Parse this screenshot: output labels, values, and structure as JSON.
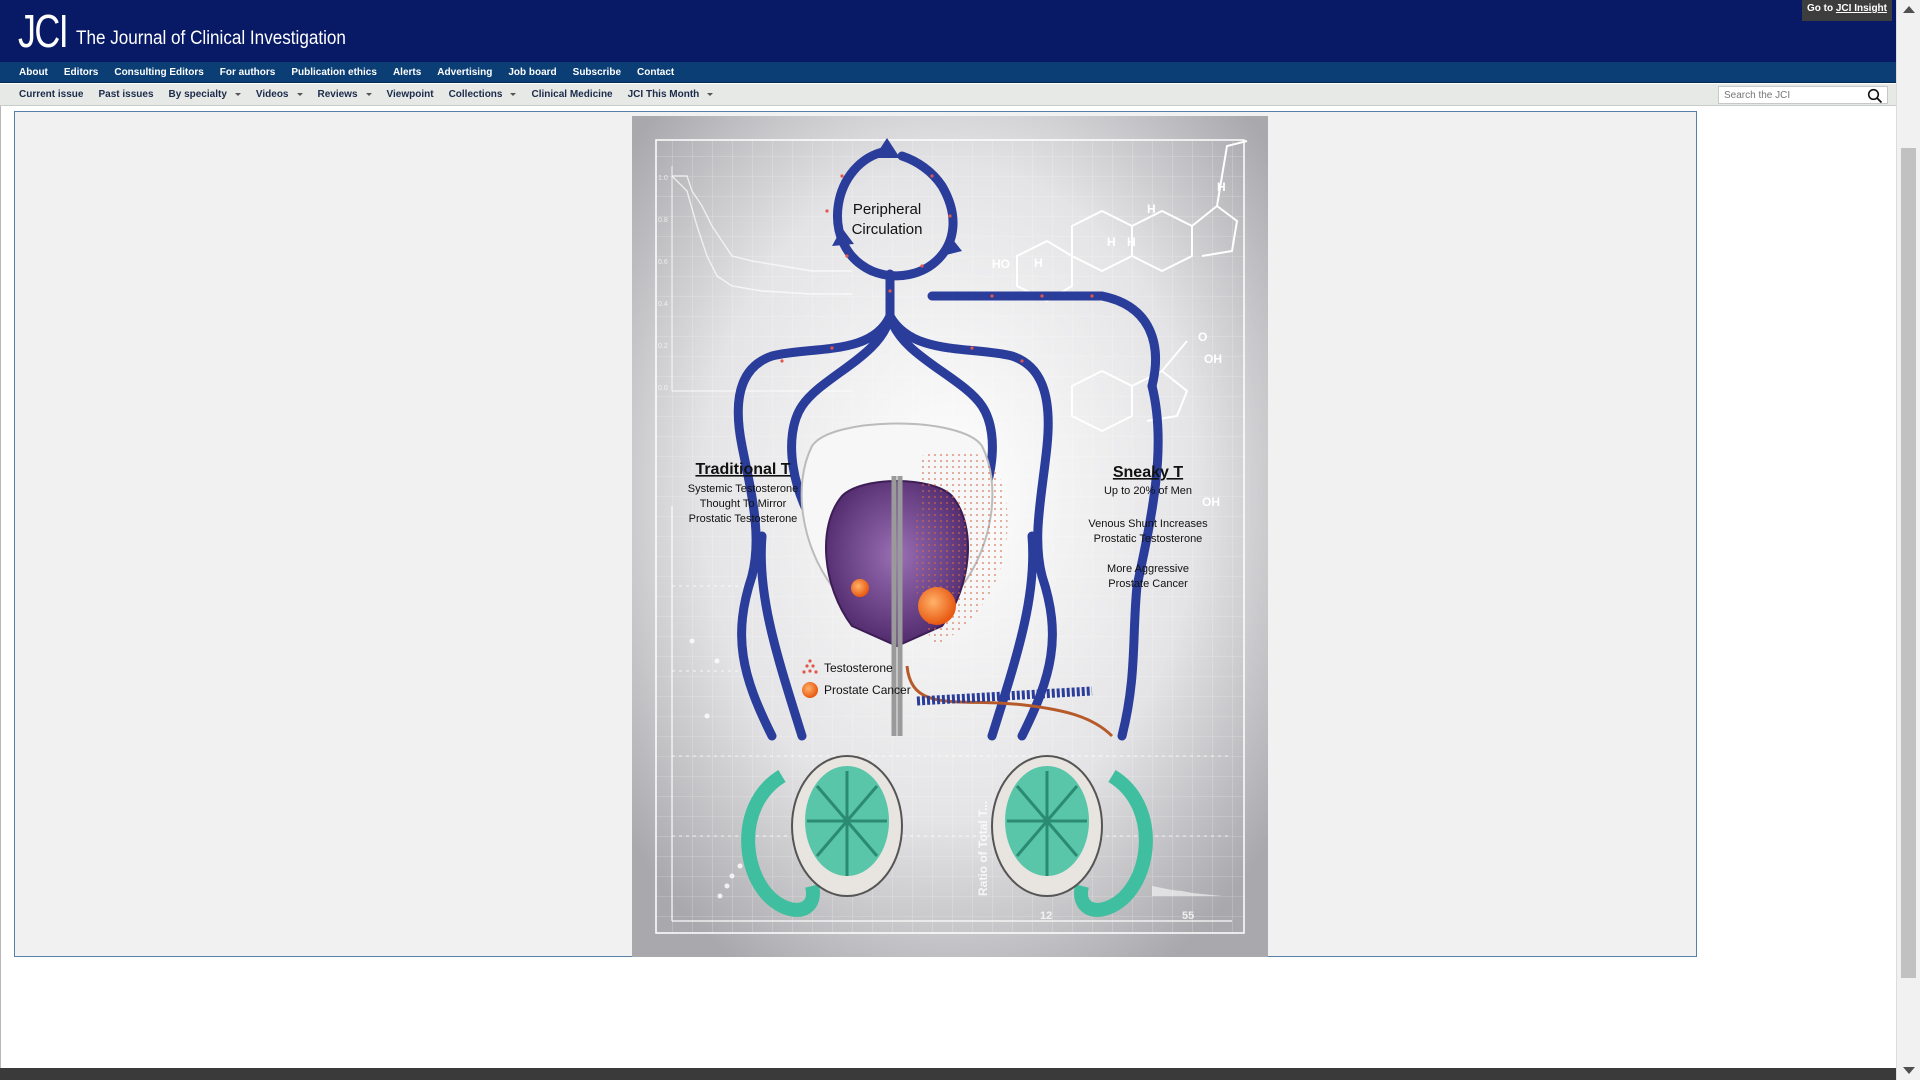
{
  "header": {
    "logo_mark": "JCI",
    "logo_text": "The Journal of Clinical Investigation",
    "insight_prefix": "Go to",
    "insight_link": "JCI Insight"
  },
  "nav_primary": [
    "About",
    "Editors",
    "Consulting Editors",
    "For authors",
    "Publication ethics",
    "Alerts",
    "Advertising",
    "Job board",
    "Subscribe",
    "Contact"
  ],
  "nav_secondary": [
    {
      "label": "Current issue",
      "dropdown": false
    },
    {
      "label": "Past issues",
      "dropdown": false
    },
    {
      "label": "By specialty",
      "dropdown": true
    },
    {
      "label": "Videos",
      "dropdown": true
    },
    {
      "label": "Reviews",
      "dropdown": true
    },
    {
      "label": "Viewpoint",
      "dropdown": false
    },
    {
      "label": "Collections",
      "dropdown": true
    },
    {
      "label": "Clinical Medicine",
      "dropdown": false
    },
    {
      "label": "JCI This Month",
      "dropdown": true
    }
  ],
  "search": {
    "placeholder": "Search the JCI",
    "value": ""
  },
  "figure": {
    "peripheral_line1": "Peripheral",
    "peripheral_line2": "Circulation",
    "traditional_title": "Traditional T",
    "traditional_l1": "Systemic Testosterone",
    "traditional_l2": "Thought To Mirror",
    "traditional_l3": "Prostatic Testosterone",
    "sneaky_title": "Sneaky T",
    "sneaky_sub": "Up to 20% of Men",
    "sneaky_l1": "Venous Shunt Increases",
    "sneaky_l2": "Prostatic Testosterone",
    "sneaky_l3": "More Aggressive",
    "sneaky_l4": "Prostate Cancer",
    "legend_testosterone": "Testosterone",
    "legend_cancer": "Prostate Cancer",
    "chem_h": "H",
    "chem_ho": "HO",
    "chem_oh": "OH",
    "chem_o": "O",
    "bg_axis_12": "12",
    "bg_axis_55": "55",
    "bg_axis_ratio": "Ratio of Total T...",
    "bg_tick_10": "1.0",
    "bg_tick_08": "0.8",
    "bg_tick_06": "0.6",
    "bg_tick_04": "0.4",
    "bg_tick_02": "0.2",
    "bg_tick_00": "0.0",
    "colors": {
      "vein": "#2a3d9a",
      "testis": "#3fbf9f",
      "prostate": "#6b3a87",
      "cancer": "#f06a1f",
      "artery": "#b65a2a"
    }
  }
}
